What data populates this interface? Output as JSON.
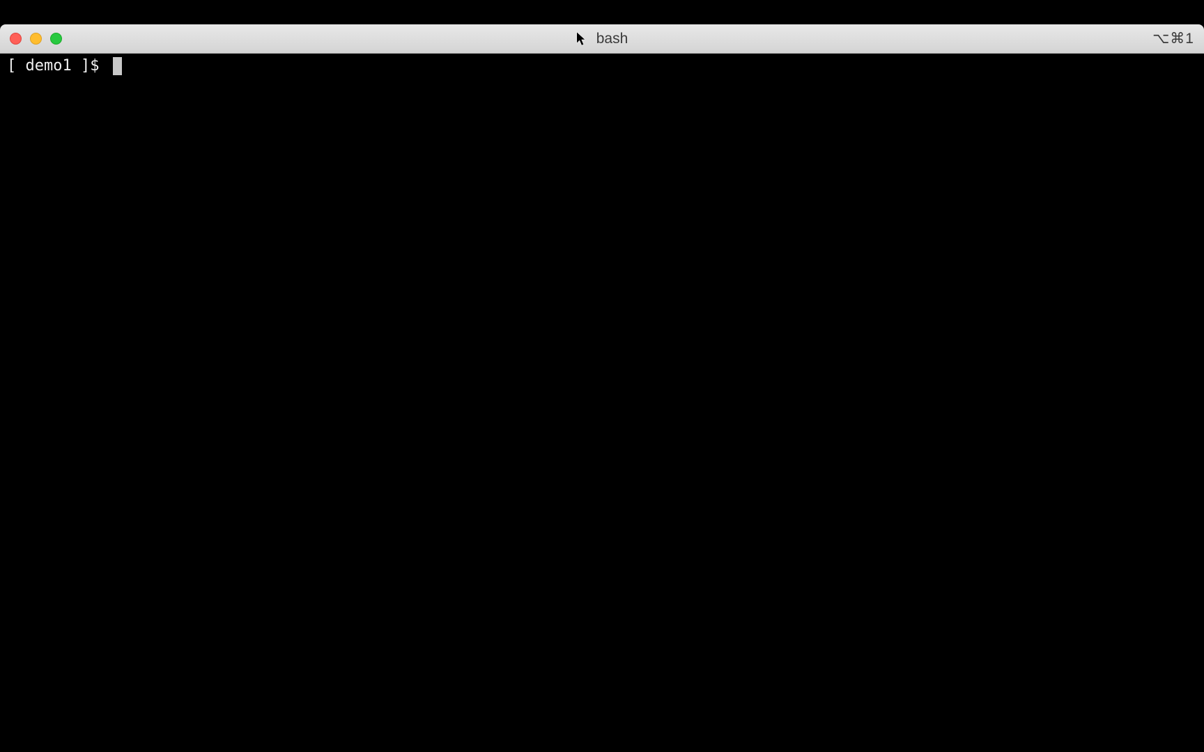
{
  "window": {
    "title": "bash",
    "shortcut_indicator": "⌥⌘1"
  },
  "terminal": {
    "prompt": "[ demo1 ]$ ",
    "command": ""
  }
}
